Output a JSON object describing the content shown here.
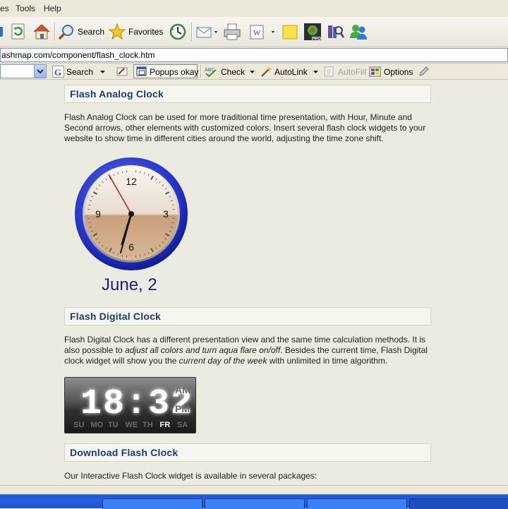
{
  "menu": [
    "es",
    "Tools",
    "Help"
  ],
  "toolbar": {
    "search": "Search",
    "favorites": "Favorites"
  },
  "address": {
    "url": "ashmap.com/component/flash_clock.htm"
  },
  "google_bar": {
    "search": "Search",
    "popups": "Popups okay",
    "check": "Check",
    "autolink": "AutoLink",
    "autofill": "AutoFill",
    "options": "Options"
  },
  "sections": {
    "analog": {
      "title": "Flash Analog Clock",
      "text": "Flash Analog Clock can be used for more traditional time presentation, with Hour, Minute and Second arrows, other elements with customized colors. Insert several flash clock widgets to your website to show time in different cities around the world, adjusting the time zone shift.",
      "date": "June, 2",
      "numerals": [
        "12",
        "3",
        "6",
        "9"
      ]
    },
    "digital": {
      "title": "Flash Digital Clock",
      "text_a": "Flash Digital Clock has a different presentation view and the same time calculation methods. It is also possible to ",
      "text_b": "adjust all colors and turn aqua flare on/off",
      "text_c": ". Besides the current time, Flash Digital clock widget will show you the ",
      "text_d": "current day of the week",
      "text_e": " with unlimited in time algorithm.",
      "time": "18:32",
      "am": "AM",
      "pm": "PM",
      "days": [
        "SU",
        "MO",
        "TU",
        "WE",
        "TH",
        "FR",
        "SA"
      ],
      "active_day": "FR"
    },
    "download": {
      "title": "Download Flash Clock",
      "text": "Our Interactive Flash Clock widget is available in several packages:"
    }
  },
  "colors": {
    "heading": "#1a3f77",
    "date": "#1c1c8c",
    "clock_rim": "#1f2fb8",
    "second_hand": "#d41616"
  }
}
